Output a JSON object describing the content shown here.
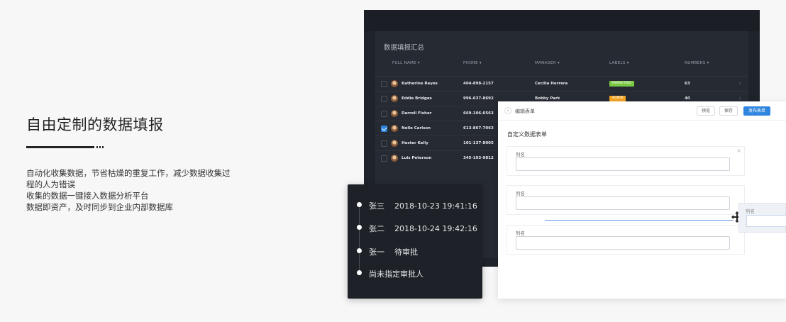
{
  "hero": {
    "title": "自由定制的数据填报",
    "desc_lines": [
      "自动化收集数据，节省枯燥的重复工作，减少数据收集过",
      "程的人为错误",
      "收集的数据一键接入数据分析平台",
      "数据即资产，及时同步到企业内部数据库"
    ]
  },
  "dashboard": {
    "title": "数据填报汇总",
    "columns": {
      "name": "FULL NAME ▾",
      "phone": "PHONE ▾",
      "manager": "MANAGER ▾",
      "labels": "LABELS ▾",
      "numbers": "NUMBERS ▾"
    },
    "rows": [
      {
        "name": "Katherine Reyes",
        "phone": "404-898-2157",
        "manager": "Cecilia Herrera",
        "label": "MARKETING",
        "label_color": "#7ac943",
        "number": "63",
        "checked": false
      },
      {
        "name": "Eddie Bridges",
        "phone": "996-637-8692",
        "manager": "Bobby Park",
        "label": "ADMIN",
        "label_color": "#f5a623",
        "number": "40",
        "checked": false
      },
      {
        "name": "Darrell Fisher",
        "phone": "669-106-0563",
        "manager": "",
        "label": "",
        "label_color": "",
        "number": "",
        "checked": false
      },
      {
        "name": "Nelle Carlson",
        "phone": "613-867-7063",
        "manager": "",
        "label": "",
        "label_color": "",
        "number": "",
        "checked": true
      },
      {
        "name": "Hester Kelly",
        "phone": "101-137-8005",
        "manager": "",
        "label": "",
        "label_color": "",
        "number": "",
        "checked": false
      },
      {
        "name": "Luis Peterson",
        "phone": "345-193-9812",
        "manager": "",
        "label": "",
        "label_color": "",
        "number": "",
        "checked": false
      }
    ]
  },
  "timeline": {
    "items": [
      {
        "who": "张三",
        "text": "2018-10-23 19:41:16"
      },
      {
        "who": "张二",
        "text": "2018-10-24 19:42:16"
      },
      {
        "who": "张一",
        "text": "待审批"
      },
      {
        "who": "",
        "text": "尚未指定审批人"
      }
    ]
  },
  "editor": {
    "back_icon": "chevron-left-icon",
    "title": "编辑表单",
    "preview_label": "预览",
    "save_label": "保存",
    "publish_label": "发布表单",
    "subtitle": "自定义数据表单",
    "fields": [
      {
        "label": "列名",
        "value": ""
      },
      {
        "label": "列名",
        "value": ""
      },
      {
        "label": "列名",
        "value": ""
      }
    ],
    "ghost_label": "列名"
  },
  "colors": {
    "accent": "#2e86de",
    "dark_panel": "#262a32"
  }
}
